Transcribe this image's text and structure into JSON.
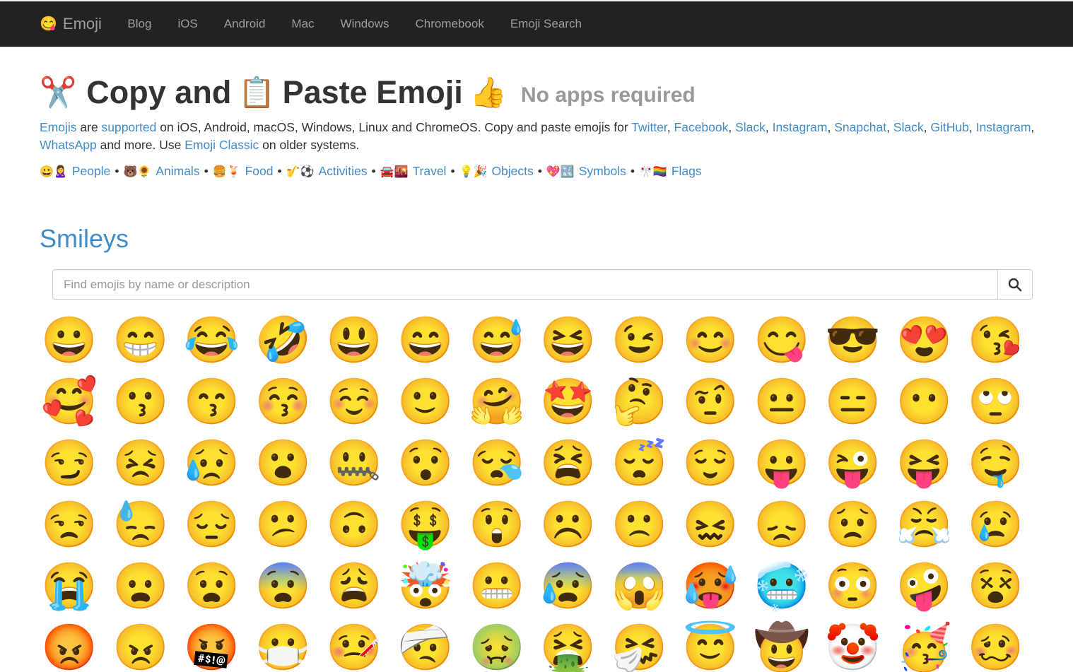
{
  "navbar": {
    "brand": {
      "icon": "😋",
      "label": "Emoji"
    },
    "links": [
      "Blog",
      "iOS",
      "Android",
      "Mac",
      "Windows",
      "Chromebook",
      "Emoji Search"
    ]
  },
  "hero": {
    "emoji_scissors": "✂️",
    "text_copy": "Copy and",
    "emoji_clipboard": "📋",
    "text_paste": "Paste Emoji",
    "emoji_thumbs": "👍",
    "subtitle": "No apps required"
  },
  "intro": {
    "link_emojis": "Emojis",
    "t1": " are ",
    "link_supported": "supported",
    "t2": " on iOS, Android, macOS, Windows, Linux and ChromeOS. Copy and paste emojis for ",
    "platforms": [
      "Twitter",
      "Facebook",
      "Slack",
      "Instagram",
      "Snapchat",
      "Slack",
      "GitHub",
      "Instagram",
      "WhatsApp"
    ],
    "t3": " and more. Use ",
    "link_classic": "Emoji Classic",
    "t4": " on older systems."
  },
  "categories": [
    {
      "emojis": "😀🙎‍♀️",
      "label": "People"
    },
    {
      "emojis": "🐻🌻",
      "label": "Animals"
    },
    {
      "emojis": "🍔🍹",
      "label": "Food"
    },
    {
      "emojis": "🎷⚽",
      "label": "Activities"
    },
    {
      "emojis": "🚘🌇",
      "label": "Travel"
    },
    {
      "emojis": "💡🎉",
      "label": "Objects"
    },
    {
      "emojis": "💖🔣",
      "label": "Symbols"
    },
    {
      "emojis": "🎌🏳️‍🌈",
      "label": "Flags"
    }
  ],
  "category_separator": "•",
  "section": {
    "title": "Smileys",
    "search_placeholder": "Find emojis by name or description",
    "search_value": ""
  },
  "emojis": [
    "😀",
    "😁",
    "😂",
    "🤣",
    "😃",
    "😄",
    "😅",
    "😆",
    "😉",
    "😊",
    "😋",
    "😎",
    "😍",
    "😘",
    "🥰",
    "😗",
    "😙",
    "😚",
    "☺️",
    "🙂",
    "🤗",
    "🤩",
    "🤔",
    "🤨",
    "😐",
    "😑",
    "😶",
    "🙄",
    "😏",
    "😣",
    "😥",
    "😮",
    "🤐",
    "😯",
    "😪",
    "😫",
    "😴",
    "😌",
    "😛",
    "😜",
    "😝",
    "🤤",
    "😒",
    "😓",
    "😔",
    "😕",
    "🙃",
    "🤑",
    "😲",
    "☹️",
    "🙁",
    "😖",
    "😞",
    "😟",
    "😤",
    "😢",
    "😭",
    "😦",
    "😧",
    "😨",
    "😩",
    "🤯",
    "😬",
    "😰",
    "😱",
    "🥵",
    "🥶",
    "😳",
    "🤪",
    "😵",
    "😡",
    "😠",
    "🤬",
    "😷",
    "🤒",
    "🤕",
    "🤢",
    "🤮",
    "🤧",
    "😇",
    "🤠",
    "🤡",
    "🥳",
    "🥴"
  ],
  "colors": {
    "navbar_bg": "#222222",
    "navbar_text": "#9d9d9d",
    "link": "#428bca",
    "subtitle": "#999999"
  }
}
